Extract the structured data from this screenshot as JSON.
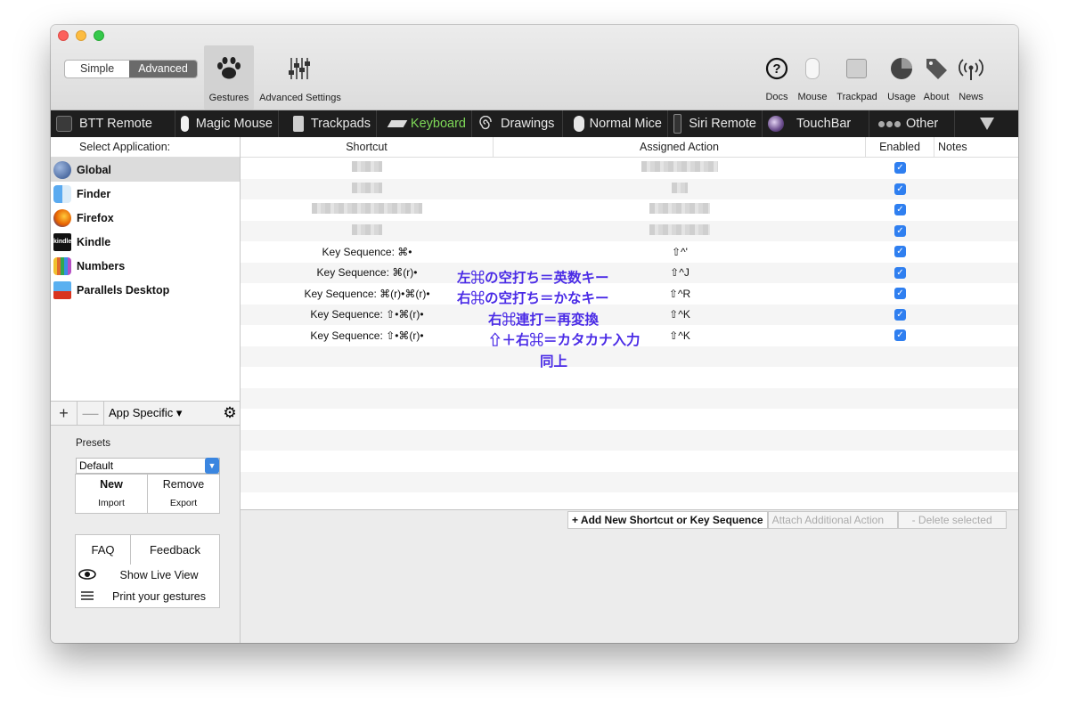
{
  "window": {
    "mode_simple": "Simple",
    "mode_advanced": "Advanced",
    "toolbar": {
      "gestures": "Gestures",
      "advanced_settings": "Advanced Settings",
      "docs": "Docs",
      "mouse": "Mouse",
      "trackpad": "Trackpad",
      "usage": "Usage",
      "about": "About",
      "news": "News"
    }
  },
  "tabs": [
    {
      "label": "BTT Remote",
      "icon": "remote-icon"
    },
    {
      "label": "Magic Mouse",
      "icon": "magic-mouse-icon"
    },
    {
      "label": "Trackpads",
      "icon": "trackpad-icon"
    },
    {
      "label": "Keyboard",
      "icon": "keyboard-icon",
      "active": true
    },
    {
      "label": "Drawings",
      "icon": "drawing-icon"
    },
    {
      "label": "Normal Mice",
      "icon": "mouse-icon"
    },
    {
      "label": "Siri Remote",
      "icon": "siri-remote-icon"
    },
    {
      "label": "TouchBar",
      "icon": "touchbar-icon"
    },
    {
      "label": "Other",
      "icon": "other-icon"
    }
  ],
  "sidebar": {
    "header": "Select Application:",
    "apps": [
      {
        "name": "Global",
        "color": "#4a6fa5"
      },
      {
        "name": "Finder",
        "color": "#3a8ee6"
      },
      {
        "name": "Firefox",
        "color": "#e66000"
      },
      {
        "name": "Kindle",
        "color": "#1a1a1a"
      },
      {
        "name": "Numbers",
        "color": "#2fa84f"
      },
      {
        "name": "Parallels Desktop",
        "color": "#d9341f"
      }
    ],
    "add": "+",
    "remove": "—",
    "app_specific": "App Specific ▾",
    "presets_label": "Presets",
    "preset_value": "Default",
    "new": "New",
    "remove_preset": "Remove",
    "import": "Import",
    "export": "Export",
    "faq": "FAQ",
    "feedback": "Feedback",
    "show_live_view": "Show Live View",
    "print_gestures": "Print your gestures"
  },
  "table": {
    "columns": [
      "Shortcut",
      "Assigned Action",
      "Enabled",
      "Notes"
    ],
    "rows": [
      {
        "shortcut": "Key Sequence: ⌘•",
        "action": "⇧^'",
        "annotation": "左⌘の空打ち＝英数キー"
      },
      {
        "shortcut": "Key Sequence: ⌘(r)•",
        "action": "⇧^J",
        "annotation": "右⌘の空打ち＝かなキー"
      },
      {
        "shortcut": "Key Sequence: ⌘(r)•⌘(r)•",
        "action": "⇧^R",
        "annotation": "右⌘連打＝再変換"
      },
      {
        "shortcut": "Key Sequence: ⇧•⌘(r)•",
        "action": "⇧^K",
        "annotation": "⇧＋右⌘＝カタカナ入力"
      },
      {
        "shortcut": "Key Sequence: ⇧•⌘(r)•",
        "action": "⇧^K",
        "annotation": "同上"
      }
    ]
  },
  "actions": {
    "add": "+ Add New Shortcut or Key Sequence",
    "attach": "Attach Additional Action",
    "delete": "- Delete selected"
  }
}
